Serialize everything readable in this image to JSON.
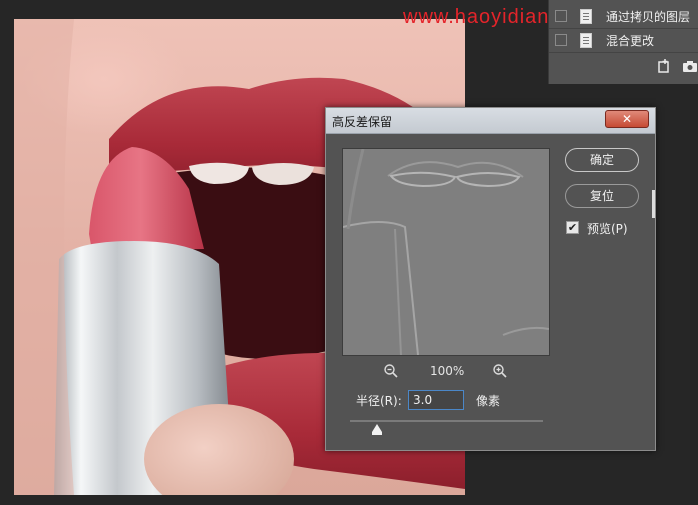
{
  "watermark": "www.haoyidian",
  "layers": {
    "items": [
      {
        "label": "通过拷贝的图层"
      },
      {
        "label": "混合更改"
      }
    ],
    "footer_icons": [
      "new-layer-icon",
      "camera-icon"
    ]
  },
  "dialog": {
    "title": "高反差保留",
    "close_label": "✕",
    "zoom": "100%",
    "ok_label": "确定",
    "reset_label": "复位",
    "preview_label": "预览(P)",
    "preview_checked": true,
    "radius_label": "半径(R):",
    "radius_value": "3.0",
    "unit": "像素",
    "slider_level": 0.14
  },
  "colors": {
    "panel": "#535353",
    "accent_input": "#4b87c8",
    "watermark": "#e4242a",
    "lip": "#b8323f"
  }
}
